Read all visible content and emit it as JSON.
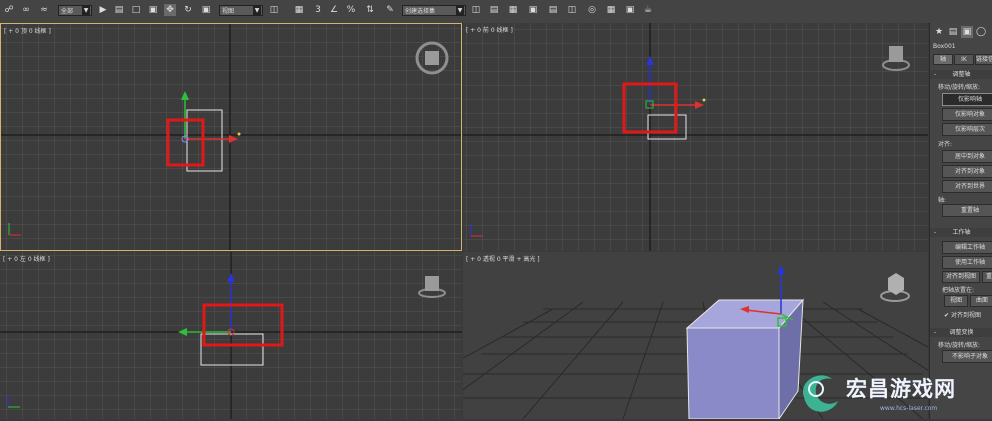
{
  "toolbar": {
    "selection_filter": "全部",
    "reference_coord": "视图",
    "named_selection": "创建选择集"
  },
  "viewports": {
    "top": "[ + 0 顶 0 线框 ]",
    "front": "[ + 0 前 0 线框 ]",
    "left": "[ + 0 左 0 线框 ]",
    "perspective": "[ + 0 透视 0 平滑 + 高光 ]"
  },
  "command_panel": {
    "object_name": "Box001",
    "tabs": [
      "轴",
      "IK",
      "链接信息"
    ],
    "adjust_pivot": {
      "header": "调整轴",
      "move_rotate_label": "移动/旋转/缩放:",
      "buttons": [
        "仅影响轴",
        "仅影响对象",
        "仅影响层次"
      ],
      "align_label": "对齐:",
      "align_buttons": [
        "居中到对象",
        "对齐到对象",
        "对齐到世界"
      ],
      "pivot_label": "轴:",
      "reset_button": "重置轴"
    },
    "working_pivot": {
      "header": "工作轴",
      "buttons": [
        "编辑工作轴",
        "使用工作轴"
      ],
      "align_view": "对齐到视图",
      "reset": "重",
      "place_label": "把轴放置在:",
      "place_buttons": [
        "视图",
        "曲面"
      ],
      "align_to_view_check": "对齐到视图"
    },
    "adjust_transform": {
      "header": "调整变换",
      "move_label": "移动/旋转/缩放:",
      "affect_children": "不影响子对象"
    }
  },
  "watermark": {
    "text": "宏昌游戏网",
    "url": "www.hcs-laser.com"
  },
  "colors": {
    "highlight_box": "#e01818",
    "active_border": "#d2b46e",
    "gizmo_x": "#e03030",
    "gizmo_y": "#2fbf3a",
    "gizmo_z": "#2a35d8",
    "box_face": "#8a8ac8"
  }
}
